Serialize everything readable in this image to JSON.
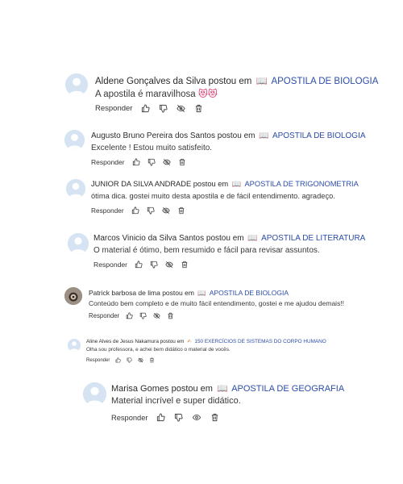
{
  "reply_label": "Responder",
  "posted_in": "postou em",
  "book_emoji": "📖",
  "hand_emoji": "✍",
  "comments": [
    {
      "author": "Aldene Gonçalves da Silva",
      "target": "APOSTILA DE BIOLOGIA",
      "text": "A apostila é maravilhosa",
      "emoji": "😻😻",
      "avatar": "default"
    },
    {
      "author": "Augusto Bruno Pereira dos Santos",
      "target": "APOSTILA DE BIOLOGIA",
      "text": "Excelente ! Estou muito satisfeito.",
      "avatar": "default"
    },
    {
      "author": "JUNIOR DA SILVA ANDRADE",
      "target": "APOSTILA DE TRIGONOMETRIA",
      "text": "ótima dica. gostei muito desta apostila e de fácil entendimento. agradeço.",
      "avatar": "default"
    },
    {
      "author": "Marcos Vinicio da Silva Santos",
      "target": "APOSTILA DE LITERATURA",
      "text": "O material é ótimo, bem resumido e fácil para revisar assuntos.",
      "avatar": "default"
    },
    {
      "author": "Patrick barbosa de lima",
      "target": "APOSTILA DE BIOLOGIA",
      "text": "Conteúdo bem completo e de muito fácil entendimento, gostei e me ajudou demais!!",
      "avatar": "photo"
    },
    {
      "author": "Aline Alves de Jesus Nakamura",
      "target": "150 EXERCÍCIOS DE SISTEMAS DO CORPO HUMANO",
      "text": "Olha sou professora, e achei bem didático o material de vocês.",
      "avatar": "default"
    },
    {
      "author": "Marisa Gomes",
      "target": "APOSTILA DE GEOGRAFIA",
      "text": "Material incrível e super didático.",
      "avatar": "default"
    }
  ]
}
